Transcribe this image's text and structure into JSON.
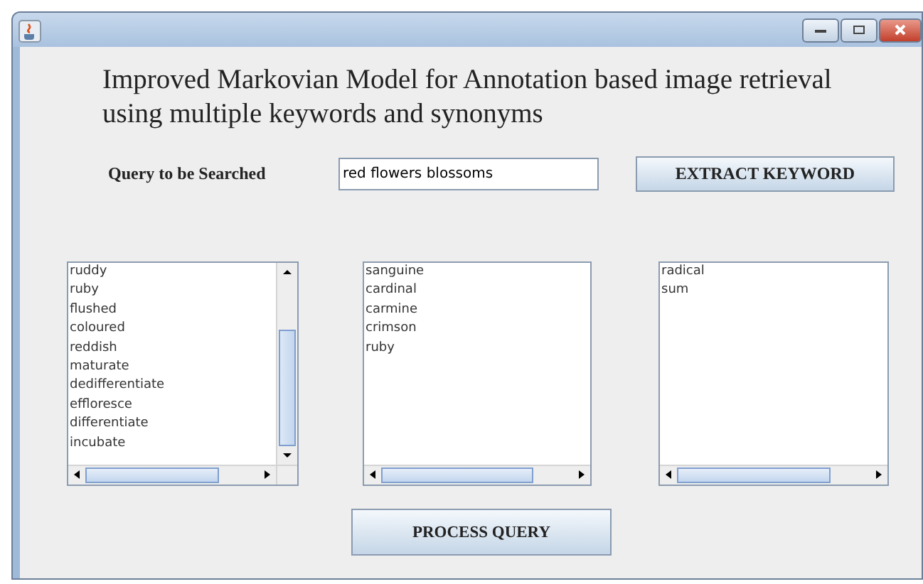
{
  "window": {
    "title_lines": [
      "Improved Markovian Model for Annotation based image retrieval",
      "using multiple keywords and synonyms"
    ]
  },
  "query": {
    "label": "Query to be Searched",
    "value": "red flowers blossoms"
  },
  "extract_button": "EXTRACT KEYWORD",
  "lists": [
    {
      "vertical_scrollbar": true,
      "items": [
        "ruddy",
        "ruby",
        "flushed",
        "coloured",
        "reddish",
        "maturate",
        "dedifferentiate",
        "effloresce",
        "differentiate",
        "incubate"
      ]
    },
    {
      "vertical_scrollbar": false,
      "items": [
        "sanguine",
        "cardinal",
        "carmine",
        "crimson",
        "ruby"
      ]
    },
    {
      "vertical_scrollbar": false,
      "items": [
        "radical",
        "sum"
      ]
    }
  ],
  "process_button": "PROCESS QUERY"
}
